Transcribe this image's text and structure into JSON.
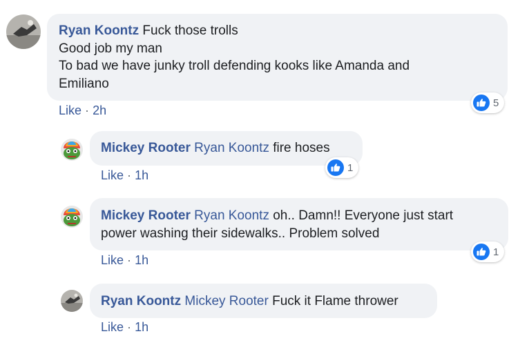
{
  "colors": {
    "link": "#385898",
    "bubble": "#f0f2f5",
    "like_blue": "#1877f2",
    "meta_gray": "#606770"
  },
  "comments": [
    {
      "author": "Ryan Koontz",
      "lines": [
        "Fuck those trolls",
        "Good job my man",
        "To bad we have junky troll defending kooks like Amanda and",
        "Emiliano"
      ],
      "like_label": "Like",
      "separator": "·",
      "time": "2h",
      "reaction_icon": "like-thumb-icon",
      "reaction_count": "5"
    },
    {
      "author": "Mickey Rooter",
      "mention": "Ryan Koontz",
      "lines": [
        "fire hoses"
      ],
      "like_label": "Like",
      "separator": "·",
      "time": "1h",
      "reaction_icon": "like-thumb-icon",
      "reaction_count": "1"
    },
    {
      "author": "Mickey Rooter",
      "mention": "Ryan Koontz",
      "lines": [
        "oh.. Damn!! Everyone just start",
        "power washing their sidewalks.. Problem solved"
      ],
      "like_label": "Like",
      "separator": "·",
      "time": "1h",
      "reaction_icon": "like-thumb-icon",
      "reaction_count": "1"
    },
    {
      "author": "Ryan Koontz",
      "mention": "Mickey Rooter",
      "lines": [
        "Fuck it Flame thrower"
      ],
      "like_label": "Like",
      "separator": "·",
      "time": "1h"
    }
  ]
}
